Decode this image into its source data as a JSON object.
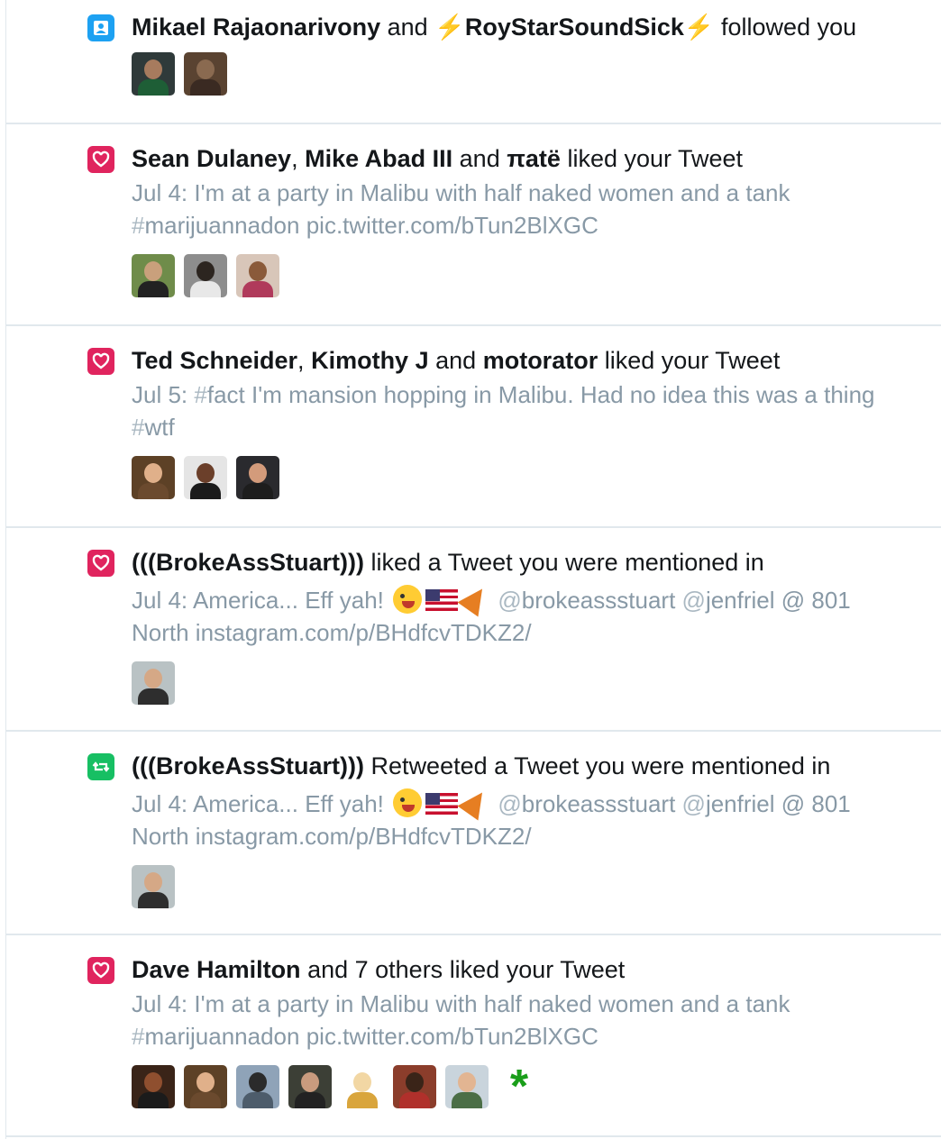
{
  "notifications": [
    {
      "type": "follow",
      "icon": "person-icon",
      "users": [
        "Mikael Rajaonarivony",
        "RoyStarSoundSick"
      ],
      "connector": "and",
      "bolt": "⚡",
      "action": "followed you",
      "avatars": [
        {
          "bg": "#2f3a3a",
          "head": "#a77b5e",
          "body": "#1e5e36"
        },
        {
          "bg": "#5a4331",
          "head": "#8a6a50",
          "body": "#3a2a22"
        }
      ]
    },
    {
      "type": "like",
      "icon": "heart-icon",
      "users": [
        "Sean Dulaney",
        "Mike Abad III",
        "πatë"
      ],
      "separator": ",",
      "connector": "and",
      "action": "liked your Tweet",
      "tweet": {
        "date": "Jul 4:",
        "text": "I'm at a party in Malibu with half naked women and a tank",
        "hash": "#",
        "tag": "marijuannadon",
        "link": "pic.twitter.com/bTun2BlXGC"
      },
      "avatars": [
        {
          "bg": "#6f8c4a",
          "head": "#c9a07c",
          "body": "#222"
        },
        {
          "bg": "#8d8d8d",
          "head": "#2c2520",
          "body": "#e8e8e8"
        },
        {
          "bg": "#d8c6b9",
          "head": "#8a5a3a",
          "body": "#b03a5b"
        }
      ]
    },
    {
      "type": "like",
      "icon": "heart-icon",
      "users": [
        "Ted Schneider",
        "Kimothy J",
        "motorator"
      ],
      "separator": ",",
      "connector": "and",
      "action": "liked your Tweet",
      "tweet": {
        "date": "Jul 5:",
        "hash": "#",
        "tag": "fact",
        "text": "I'm mansion hopping in Malibu. Had no idea this was a thing",
        "tag2": "wtf"
      },
      "avatars": [
        {
          "bg": "#5d4126",
          "head": "#e0b08a",
          "body": "#6b4a2e"
        },
        {
          "bg": "#e5e5e5",
          "head": "#6b3f2a",
          "body": "#1b1b1b"
        },
        {
          "bg": "#2a2a2e",
          "head": "#d39b7b",
          "body": "#1d1d1d"
        }
      ]
    },
    {
      "type": "like",
      "icon": "heart-icon",
      "users": [
        "(((BrokeAssStuart)))"
      ],
      "action": "liked a Tweet you were mentioned in",
      "tweet": {
        "date": "Jul 4:",
        "text": "America... Eff yah!",
        "at": "@",
        "m1": "brokeassstuart",
        "m2": "jenfriel",
        "place": "@ 801",
        "line2": "North instagram.com/p/BHdfcvTDKZ2/"
      },
      "avatars": [
        {
          "bg": "#b9c2c4",
          "head": "#d5a886",
          "body": "#2e2e2e"
        }
      ]
    },
    {
      "type": "retweet",
      "icon": "retweet-icon",
      "users": [
        "(((BrokeAssStuart)))"
      ],
      "action": "Retweeted a Tweet you were mentioned in",
      "tweet": {
        "date": "Jul 4:",
        "text": "America... Eff yah!",
        "at": "@",
        "m1": "brokeassstuart",
        "m2": "jenfriel",
        "place": "@ 801",
        "line2": "North instagram.com/p/BHdfcvTDKZ2/"
      },
      "avatars": [
        {
          "bg": "#b9c2c4",
          "head": "#d5a886",
          "body": "#2e2e2e"
        }
      ]
    },
    {
      "type": "like",
      "icon": "heart-icon",
      "users": [
        "Dave Hamilton"
      ],
      "action": "and 7 others liked your Tweet",
      "tweet": {
        "date": "Jul 4:",
        "text": "I'm at a party in Malibu with half naked women and a tank",
        "hash": "#",
        "tag": "marijuannadon",
        "link": "pic.twitter.com/bTun2BlXGC"
      },
      "avatars": [
        {
          "bg": "#3a2418",
          "head": "#8f4f2f",
          "body": "#1b1b1b"
        },
        {
          "bg": "#5d4126",
          "head": "#e0b08a",
          "body": "#6b4a2e"
        },
        {
          "bg": "#8fa3b8",
          "head": "#2b2b2b",
          "body": "#4d5c6b"
        },
        {
          "bg": "#3c3f36",
          "head": "#c99b7e",
          "body": "#222"
        },
        {
          "bg": "#ffffff",
          "head": "#ffffff",
          "body": "#d9a53c"
        },
        {
          "bg": "#8b3d2b",
          "head": "#3a2418",
          "body": "#b0302b"
        },
        {
          "bg": "#c9d4dc",
          "head": "#e2b592",
          "body": "#4b6e46"
        }
      ],
      "extra_star": "*"
    }
  ],
  "colors": {
    "follow": "#1da1f2",
    "like": "#e0245e",
    "retweet": "#17bf63",
    "muted": "#8899a6",
    "text": "#14171a",
    "bolt": "#f5a623"
  }
}
